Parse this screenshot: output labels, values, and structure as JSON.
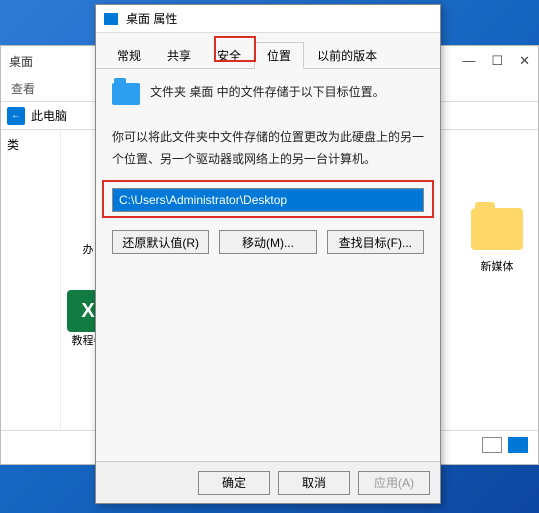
{
  "explorer": {
    "title": "桌面",
    "toolbar": {
      "view": "查看"
    },
    "nav": {
      "breadcrumb": "此电脑"
    },
    "side": {
      "label": "类"
    },
    "items": {
      "excel_label": "教程卷",
      "folder_label": "办",
      "media_label": "新媒体"
    },
    "controls": {
      "min": "—",
      "max": "☐",
      "close": "✕"
    }
  },
  "dialog": {
    "title": "桌面 属性",
    "tabs": {
      "general": "常规",
      "sharing": "共享",
      "security": "安全",
      "location": "位置",
      "previous": "以前的版本"
    },
    "line1": "文件夹 桌面 中的文件存储于以下目标位置。",
    "desc": "你可以将此文件夹中文件存储的位置更改为此硬盘上的另一个位置、另一个驱动器或网络上的另一台计算机。",
    "path": "C:\\Users\\Administrator\\Desktop",
    "buttons": {
      "restore": "还原默认值(R)",
      "move": "移动(M)...",
      "find": "查找目标(F)..."
    },
    "footer": {
      "ok": "确定",
      "cancel": "取消",
      "apply": "应用(A)"
    }
  }
}
